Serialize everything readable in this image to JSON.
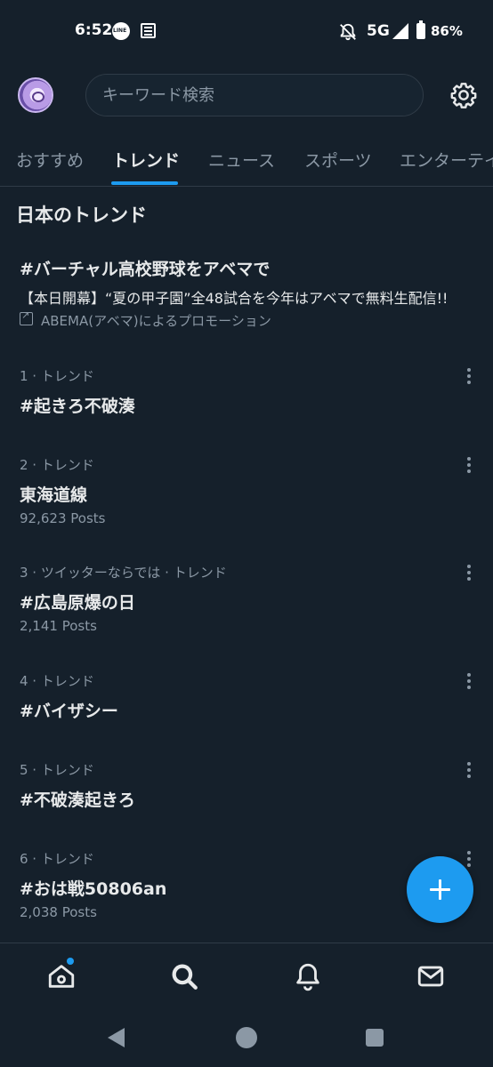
{
  "status_bar": {
    "time": "6:52",
    "network": "5G",
    "battery": "86%",
    "icons": [
      "line-icon",
      "news-icon",
      "bell-off-icon",
      "signal-icon",
      "battery-icon"
    ]
  },
  "header": {
    "search_placeholder": "キーワード検索"
  },
  "tabs": [
    {
      "label": "おすすめ",
      "active": false
    },
    {
      "label": "トレンド",
      "active": true
    },
    {
      "label": "ニュース",
      "active": false
    },
    {
      "label": "スポーツ",
      "active": false
    },
    {
      "label": "エンターテイ",
      "active": false
    }
  ],
  "section_title": "日本のトレンド",
  "promoted": {
    "title": "#バーチャル高校野球をアベマで",
    "description": "【本日開幕】“夏の甲子園”全48試合を今年はアベマで無料生配信!!",
    "promoted_by": "ABEMA(アベマ)によるプロモーション"
  },
  "trends": [
    {
      "meta": "1 · トレンド",
      "name": "#起きろ不破湊",
      "posts": ""
    },
    {
      "meta": "2 · トレンド",
      "name": "東海道線",
      "posts": "92,623 Posts"
    },
    {
      "meta": "3 · ツイッターならでは · トレンド",
      "name": "#広島原爆の日",
      "posts": "2,141 Posts"
    },
    {
      "meta": "4 · トレンド",
      "name": "#バイザシー",
      "posts": ""
    },
    {
      "meta": "5 · トレンド",
      "name": "#不破湊起きろ",
      "posts": ""
    },
    {
      "meta": "6 · トレンド",
      "name": "#おは戦50806an",
      "posts": "2,038 Posts"
    }
  ],
  "colors": {
    "background": "#15202b",
    "accent": "#1d9bf0",
    "text_primary": "#e7e9ea",
    "text_secondary": "#8b98a5"
  }
}
